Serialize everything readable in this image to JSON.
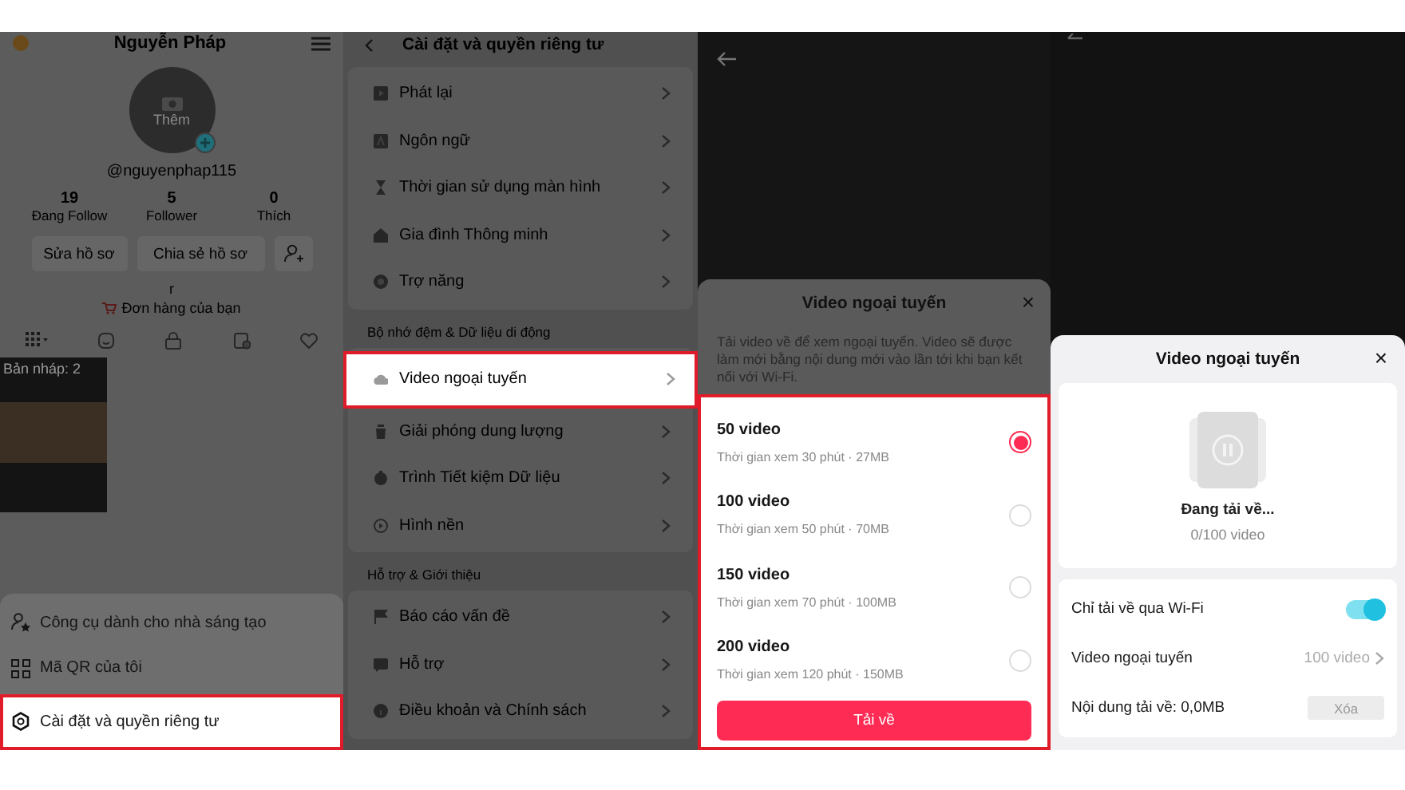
{
  "profile_screen": {
    "title": "Nguyễn Pháp",
    "avatar_label": "Thêm",
    "handle": "@nguyenphap115",
    "stats": [
      {
        "value": "19",
        "label": "Đang Follow"
      },
      {
        "value": "5",
        "label": "Follower"
      },
      {
        "value": "0",
        "label": "Thích"
      }
    ],
    "buttons": [
      "Sửa hồ sơ",
      "Chia sẻ hồ sơ"
    ],
    "bio": "r",
    "orders_link": "Đơn hàng của bạn",
    "draft_label": "Bản nháp: 2",
    "menu": [
      {
        "label": "Công cụ dành cho nhà sáng tạo",
        "selected": false
      },
      {
        "label": "Mã QR của tôi",
        "selected": false
      },
      {
        "label": "Cài đặt và quyền riêng tư",
        "selected": true
      }
    ]
  },
  "settings_screen": {
    "title": "Cài đặt và quyền riêng tư",
    "groups": [
      {
        "items": [
          {
            "label": "Phát lại",
            "selected": false
          },
          {
            "label": "Ngôn ngữ",
            "selected": false
          },
          {
            "label": "Thời gian sử dụng màn hình",
            "selected": false
          },
          {
            "label": "Gia đình Thông minh",
            "selected": false
          },
          {
            "label": "Trợ năng",
            "selected": false
          }
        ]
      },
      {
        "header": "Bộ nhớ đệm & Dữ liệu di động",
        "items": [
          {
            "label": "Video ngoại tuyến",
            "selected": true
          },
          {
            "label": "Giải phóng dung lượng",
            "selected": false
          },
          {
            "label": "Trình Tiết kiệm Dữ liệu",
            "selected": false
          },
          {
            "label": "Hình nền",
            "selected": false
          }
        ]
      },
      {
        "header": "Hỗ trợ & Giới thiệu",
        "items": [
          {
            "label": "Báo cáo vấn đề",
            "selected": false
          },
          {
            "label": "Hỗ trợ",
            "selected": false
          },
          {
            "label": "Điều khoản và Chính sách",
            "selected": false
          }
        ]
      }
    ]
  },
  "offline_sheet": {
    "title": "Video ngoại tuyến",
    "close": "×",
    "description": "Tải video về để xem ngoại tuyến. Video sẽ được làm mới bằng nội dung mới vào lần tới khi bạn kết nối với Wi-Fi.",
    "highlighted": true,
    "options": [
      {
        "label": "50 video",
        "detail": "Thời gian xem 30 phút · 27MB",
        "selected": true
      },
      {
        "label": "100 video",
        "detail": "Thời gian xem 50 phút · 70MB",
        "selected": false
      },
      {
        "label": "150 video",
        "detail": "Thời gian xem 70 phút · 100MB",
        "selected": false
      },
      {
        "label": "200 video",
        "detail": "Thời gian xem 120 phút · 150MB",
        "selected": false
      }
    ],
    "button": "Tải về"
  },
  "download_sheet": {
    "title": "Video ngoại tuyến",
    "close": "×",
    "status": "Đang tải về...",
    "progress": "0/100 video",
    "wifi_only": {
      "label": "Chỉ tải về qua Wi-Fi",
      "on": true
    },
    "offline_videos": {
      "label": "Video ngoại tuyến",
      "value": "100 video"
    },
    "storage": {
      "label": "Nội dung tải về: 0,0MB",
      "button": "Xóa"
    }
  }
}
